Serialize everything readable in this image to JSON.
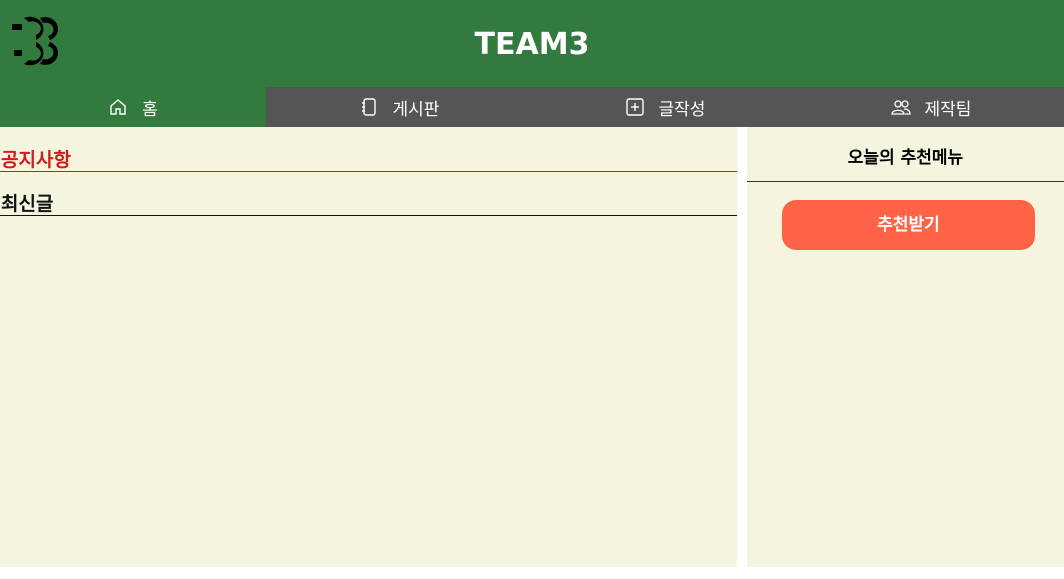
{
  "header": {
    "title": "TEAM3",
    "logo_icon": "team3-logo-icon",
    "background": "#327a3e"
  },
  "nav": {
    "items": [
      {
        "label": "홈",
        "icon": "home-icon",
        "active": true
      },
      {
        "label": "게시판",
        "icon": "notebook-icon",
        "active": false
      },
      {
        "label": "글작성",
        "icon": "plus-square-icon",
        "active": false
      },
      {
        "label": "제작팀",
        "icon": "team-icon",
        "active": false
      }
    ],
    "background": "#555555",
    "active_background": "#327a3e"
  },
  "main": {
    "notice_title": "공지사항",
    "recent_title": "최신글",
    "notice_color": "#d11a1a"
  },
  "sidebar": {
    "title": "오늘의 추천메뉴",
    "button_label": "추천받기",
    "button_color": "#ff6347"
  }
}
